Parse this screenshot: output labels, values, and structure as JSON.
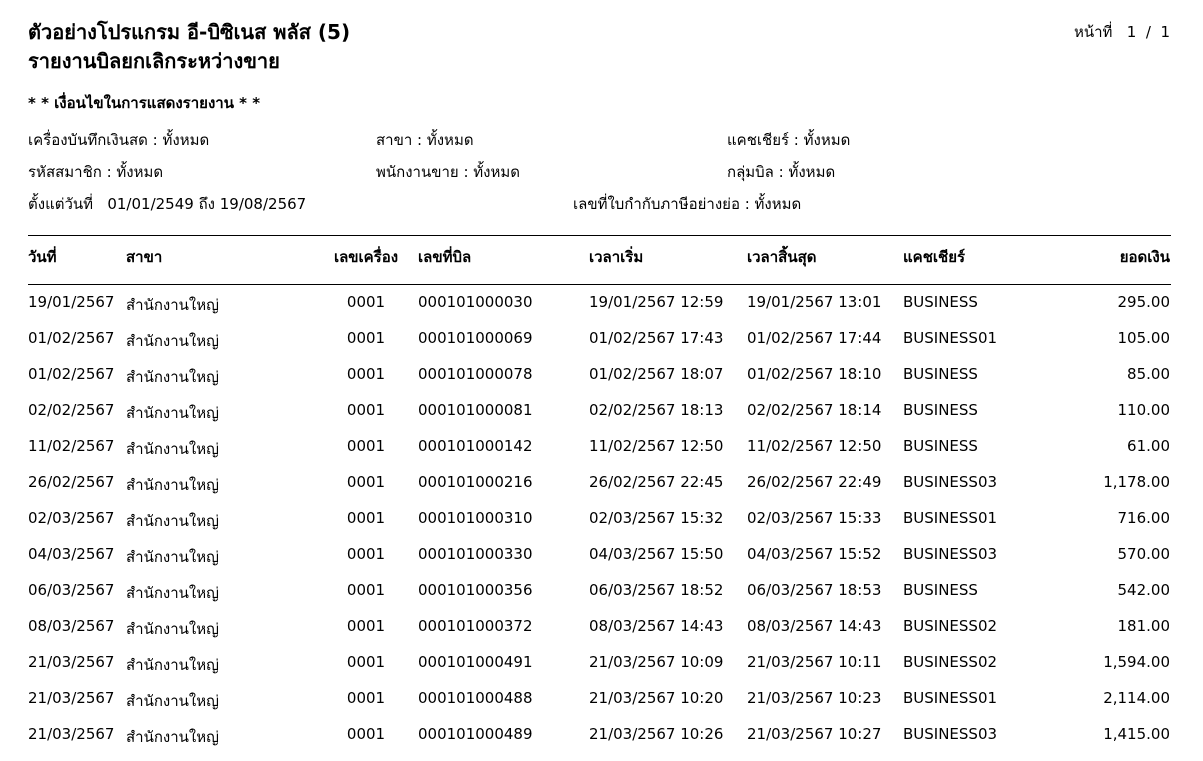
{
  "report": {
    "company_title": "ตัวอย่างโปรแกรม อี-บิซิเนส พลัส (5)",
    "report_title": "รายงานบิลยกเลิกระหว่างขาย",
    "page_label": "หน้าที่",
    "page_current": "1",
    "page_sep": "/",
    "page_total": "1"
  },
  "conditions": {
    "heading": "* * เงื่อนไขในการแสดงรายงาน * *",
    "pos_machine": "เครื่องบันทึกเงินสด : ทั้งหมด",
    "branch": "สาขา : ทั้งหมด",
    "cashier": "แคชเชียร์ : ทั้งหมด",
    "member_code": "รหัสสมาชิก : ทั้งหมด",
    "salesperson": "พนักงานขาย : ทั้งหมด",
    "bill_group": "กลุ่มบิล : ทั้งหมด",
    "date_range": "ตั้งแต่วันที่   01/01/2549 ถึง 19/08/2567",
    "tax_invoice": "เลขที่ใบกำกับภาษีอย่างย่อ : ทั้งหมด"
  },
  "table": {
    "headers": {
      "date": "วันที่",
      "branch": "สาขา",
      "machine": "เลขเครื่อง",
      "bill_no": "เลขที่บิล",
      "start_time": "เวลาเริ่ม",
      "end_time": "เวลาสิ้นสุด",
      "cashier": "แคชเชียร์",
      "amount": "ยอดเงิน"
    },
    "rows": [
      {
        "date": "19/01/2567",
        "branch": "สำนักงานใหญ่",
        "machine": "0001",
        "bill_no": "000101000030",
        "start_time": "19/01/2567 12:59",
        "end_time": "19/01/2567 13:01",
        "cashier": "BUSINESS",
        "amount": "295.00"
      },
      {
        "date": "01/02/2567",
        "branch": "สำนักงานใหญ่",
        "machine": "0001",
        "bill_no": "000101000069",
        "start_time": "01/02/2567 17:43",
        "end_time": "01/02/2567 17:44",
        "cashier": "BUSINESS01",
        "amount": "105.00"
      },
      {
        "date": "01/02/2567",
        "branch": "สำนักงานใหญ่",
        "machine": "0001",
        "bill_no": "000101000078",
        "start_time": "01/02/2567 18:07",
        "end_time": "01/02/2567 18:10",
        "cashier": "BUSINESS",
        "amount": "85.00"
      },
      {
        "date": "02/02/2567",
        "branch": "สำนักงานใหญ่",
        "machine": "0001",
        "bill_no": "000101000081",
        "start_time": "02/02/2567 18:13",
        "end_time": "02/02/2567 18:14",
        "cashier": "BUSINESS",
        "amount": "110.00"
      },
      {
        "date": "11/02/2567",
        "branch": "สำนักงานใหญ่",
        "machine": "0001",
        "bill_no": "000101000142",
        "start_time": "11/02/2567 12:50",
        "end_time": "11/02/2567 12:50",
        "cashier": "BUSINESS",
        "amount": "61.00"
      },
      {
        "date": "26/02/2567",
        "branch": "สำนักงานใหญ่",
        "machine": "0001",
        "bill_no": "000101000216",
        "start_time": "26/02/2567 22:45",
        "end_time": "26/02/2567 22:49",
        "cashier": "BUSINESS03",
        "amount": "1,178.00"
      },
      {
        "date": "02/03/2567",
        "branch": "สำนักงานใหญ่",
        "machine": "0001",
        "bill_no": "000101000310",
        "start_time": "02/03/2567 15:32",
        "end_time": "02/03/2567 15:33",
        "cashier": "BUSINESS01",
        "amount": "716.00"
      },
      {
        "date": "04/03/2567",
        "branch": "สำนักงานใหญ่",
        "machine": "0001",
        "bill_no": "000101000330",
        "start_time": "04/03/2567 15:50",
        "end_time": "04/03/2567 15:52",
        "cashier": "BUSINESS03",
        "amount": "570.00"
      },
      {
        "date": "06/03/2567",
        "branch": "สำนักงานใหญ่",
        "machine": "0001",
        "bill_no": "000101000356",
        "start_time": "06/03/2567 18:52",
        "end_time": "06/03/2567 18:53",
        "cashier": "BUSINESS",
        "amount": "542.00"
      },
      {
        "date": "08/03/2567",
        "branch": "สำนักงานใหญ่",
        "machine": "0001",
        "bill_no": "000101000372",
        "start_time": "08/03/2567 14:43",
        "end_time": "08/03/2567 14:43",
        "cashier": "BUSINESS02",
        "amount": "181.00"
      },
      {
        "date": "21/03/2567",
        "branch": "สำนักงานใหญ่",
        "machine": "0001",
        "bill_no": "000101000491",
        "start_time": "21/03/2567 10:09",
        "end_time": "21/03/2567 10:11",
        "cashier": "BUSINESS02",
        "amount": "1,594.00"
      },
      {
        "date": "21/03/2567",
        "branch": "สำนักงานใหญ่",
        "machine": "0001",
        "bill_no": "000101000488",
        "start_time": "21/03/2567 10:20",
        "end_time": "21/03/2567 10:23",
        "cashier": "BUSINESS01",
        "amount": "2,114.00"
      },
      {
        "date": "21/03/2567",
        "branch": "สำนักงานใหญ่",
        "machine": "0001",
        "bill_no": "000101000489",
        "start_time": "21/03/2567 10:26",
        "end_time": "21/03/2567 10:27",
        "cashier": "BUSINESS03",
        "amount": "1,415.00"
      }
    ]
  }
}
